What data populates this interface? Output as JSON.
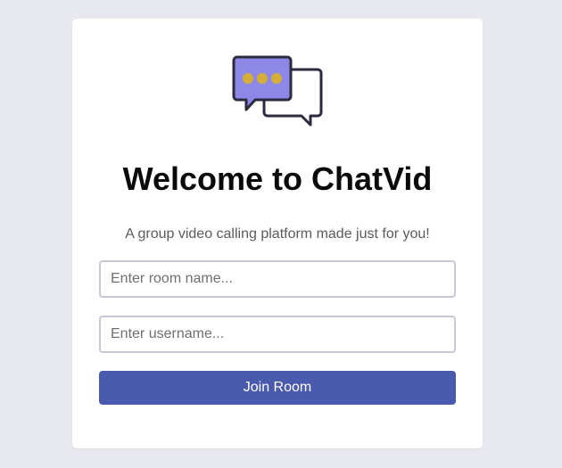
{
  "logo": {
    "icon": "chat-bubbles-icon",
    "colors": {
      "front_bubble": "#8d87e6",
      "outline": "#2b2b3d",
      "dots": "#d4af37"
    }
  },
  "header": {
    "title": "Welcome to ChatVid",
    "subtitle": "A group video calling platform made just for you!"
  },
  "form": {
    "room_placeholder": "Enter room name...",
    "room_value": "",
    "username_placeholder": "Enter username...",
    "username_value": "",
    "join_label": "Join Room"
  },
  "colors": {
    "background": "#e8e9ee",
    "card": "#ffffff",
    "button": "#4a5aad",
    "input_border": "#c8c9d6"
  }
}
